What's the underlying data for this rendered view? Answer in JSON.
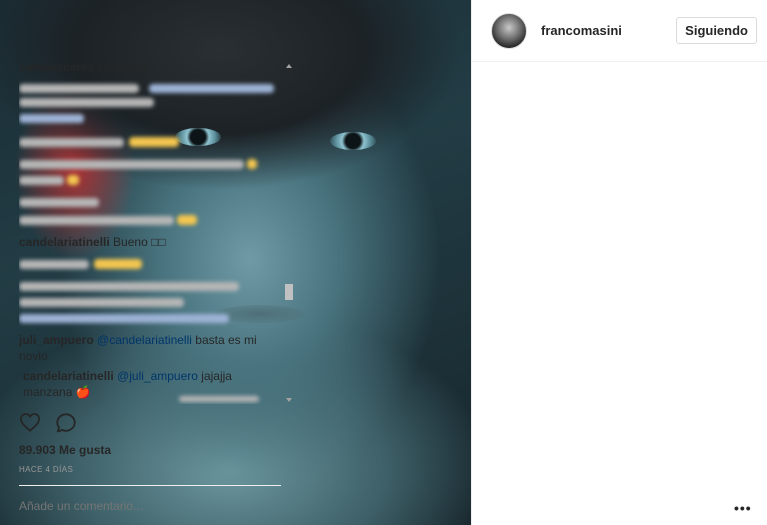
{
  "post": {
    "username": "francomasini",
    "follow_label": "Siguiendo"
  },
  "comments": {
    "partial_top": {
      "user": "camilacceres",
      "text": "Nhahaha"
    },
    "c1": {
      "user": "candelariatinelli",
      "text": "Bueno",
      "emoji": "□□"
    },
    "c2": {
      "user": "juli_ampuero",
      "mention": "@candelariatinelli",
      "text1": " basta es mi",
      "text2": "novio"
    },
    "c3": {
      "user": "candelariatinelli",
      "mention": "@juli_ampuero",
      "text1": " jajajja",
      "text2": "manzana",
      "emoji": "🍎"
    }
  },
  "footer": {
    "likes": "89.903 Me gusta",
    "time_ago": "HACE 4 DÍAS",
    "comment_placeholder": "Añade un comentario...",
    "more_label": "•••"
  },
  "icons": {
    "heart": "heart-icon",
    "comment": "comment-icon"
  }
}
